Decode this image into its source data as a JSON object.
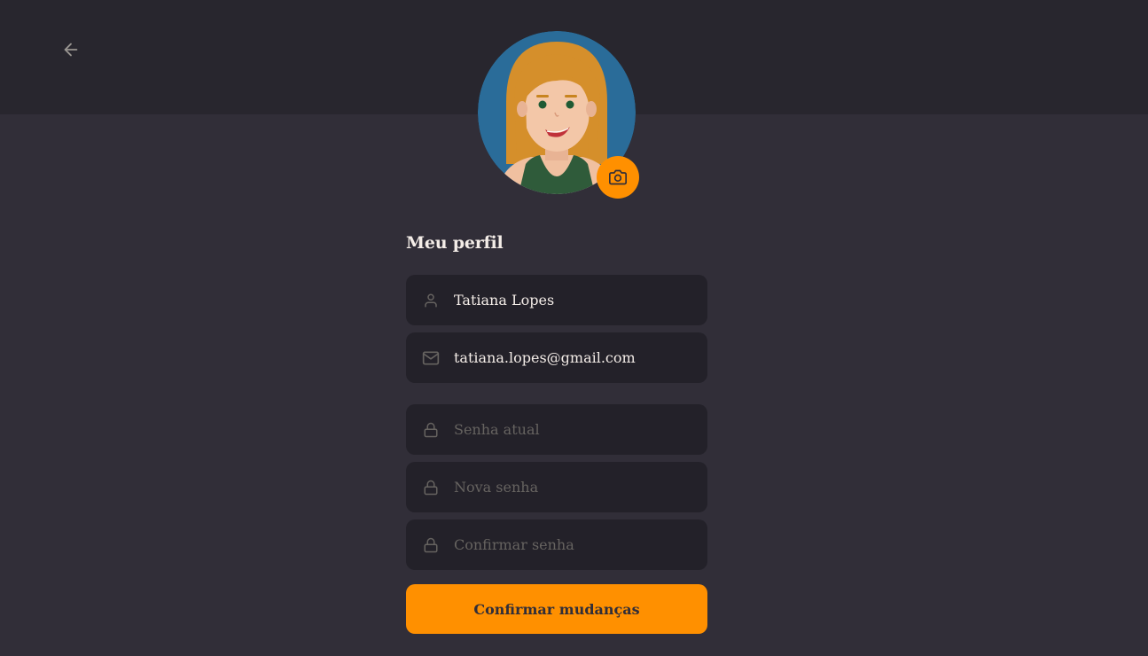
{
  "header": {
    "back_icon": "arrow-left-icon"
  },
  "avatar": {
    "camera_icon": "camera-icon"
  },
  "form": {
    "title": "Meu perfil",
    "name": {
      "value": "Tatiana Lopes",
      "icon": "user-icon"
    },
    "email": {
      "value": "tatiana.lopes@gmail.com",
      "icon": "mail-icon"
    },
    "current_password": {
      "placeholder": "Senha atual",
      "icon": "lock-icon"
    },
    "new_password": {
      "placeholder": "Nova senha",
      "icon": "lock-icon"
    },
    "confirm_password": {
      "placeholder": "Confirmar senha",
      "icon": "lock-icon"
    },
    "submit_label": "Confirmar mudanças"
  },
  "colors": {
    "background": "#312e38",
    "topbar": "#28262e",
    "input_bg": "#232129",
    "accent": "#ff9000",
    "text": "#f4ede8",
    "placeholder": "#666360"
  }
}
